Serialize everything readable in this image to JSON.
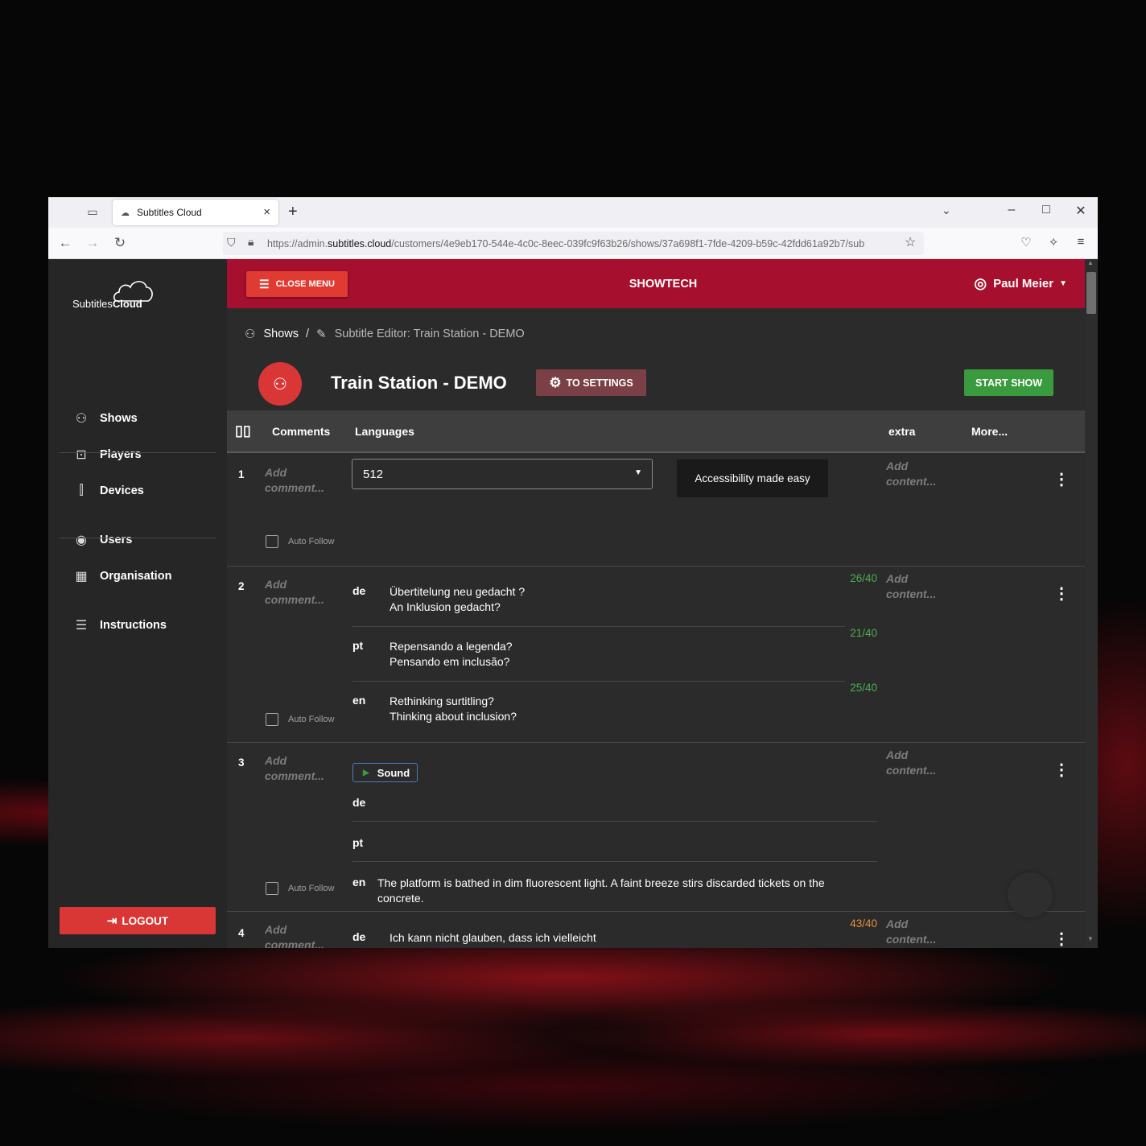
{
  "browser": {
    "tab_title": "Subtitles Cloud",
    "url_prefix": "https://admin.",
    "url_domain": "subtitles.cloud",
    "url_path": "/customers/4e9eb170-544e-4c0c-8eec-039fc9f63b26/shows/37a698f1-7fde-4209-b59c-42fdd61a92b7/sub"
  },
  "logo": {
    "text_light": "Subtitles",
    "text_bold": "Cloud"
  },
  "sidebar": {
    "items": [
      {
        "label": "Shows",
        "icon": "masks-icon"
      },
      {
        "label": "Players",
        "icon": "cast-icon"
      },
      {
        "label": "Devices",
        "icon": "devices-icon"
      },
      {
        "label": "Users",
        "icon": "user-circle-icon"
      },
      {
        "label": "Organisation",
        "icon": "building-icon"
      },
      {
        "label": "Instructions",
        "icon": "instructions-icon"
      }
    ],
    "logout_label": "LOGOUT"
  },
  "topbar": {
    "close_menu_label": "CLOSE MENU",
    "title": "SHOWTECH",
    "user_name": "Paul Meier"
  },
  "breadcrumb": {
    "root": "Shows",
    "sep": "/",
    "current": "Subtitle Editor: Train Station - DEMO"
  },
  "show": {
    "title": "Train Station - DEMO",
    "settings_label": "TO SETTINGS",
    "start_label": "START SHOW"
  },
  "table": {
    "headers": {
      "comments": "Comments",
      "languages": "Languages",
      "extra": "extra",
      "more": "More..."
    },
    "add_comment": "Add comment...",
    "add_content": "Add content...",
    "auto_follow": "Auto Follow",
    "rows": [
      {
        "num": "1",
        "select_value": "512",
        "tooltip": "Accessibility made easy"
      },
      {
        "num": "2",
        "langs": [
          {
            "code": "de",
            "line1": "Übertitelung neu gedacht ?",
            "line2": "An Inklusion gedacht?",
            "count": "26/40"
          },
          {
            "code": "pt",
            "line1": "Repensando a legenda?",
            "line2": "Pensando em inclusão?",
            "count": "21/40"
          },
          {
            "code": "en",
            "line1": "Rethinking surtitling?",
            "line2": "Thinking about inclusion?",
            "count": "25/40"
          }
        ]
      },
      {
        "num": "3",
        "sound_label": "Sound",
        "langs": [
          {
            "code": "de",
            "text": ""
          },
          {
            "code": "pt",
            "text": ""
          },
          {
            "code": "en",
            "line1": "The platform is bathed in dim fluorescent light. A faint breeze stirs discarded tickets on the",
            "line2": "concrete."
          }
        ]
      },
      {
        "num": "4",
        "langs": [
          {
            "code": "de",
            "line1": "Ich kann nicht glauben, dass ich vielleicht",
            "count": "43/40"
          }
        ]
      }
    ]
  },
  "colors": {
    "topbar": "#a60f2d",
    "accent_red": "#d93636",
    "start_green": "#3a9a3e",
    "counter_ok": "#4caf50",
    "counter_over": "#e8903a"
  }
}
